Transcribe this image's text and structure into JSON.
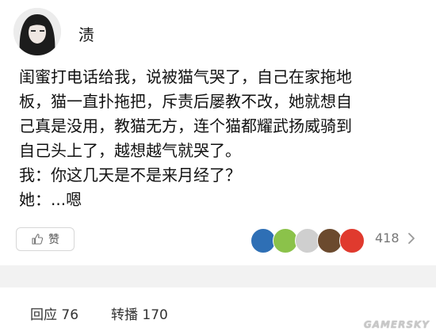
{
  "user": {
    "name": "渍"
  },
  "post": {
    "lines": [
      "闺蜜打电话给我，说被猫气哭了，自己在家拖地",
      "板，猫一直扑拖把，斥责后屡教不改，她就想自",
      "己真是没用，教猫无方，连个猫都耀武扬威骑到",
      "自己头上了，越想越气就哭了。",
      "我：你这几天是不是来月经了？",
      "她：...嗯"
    ]
  },
  "like": {
    "label": "赞",
    "count": "418"
  },
  "liker_colors": [
    "#2e6fb5",
    "#8bc24a",
    "#cfcfcf",
    "#6b4a2e",
    "#e03a2e"
  ],
  "stats": {
    "replies": "回应 76",
    "reposts": "转播 170"
  },
  "watermark": "GAMERSKY"
}
